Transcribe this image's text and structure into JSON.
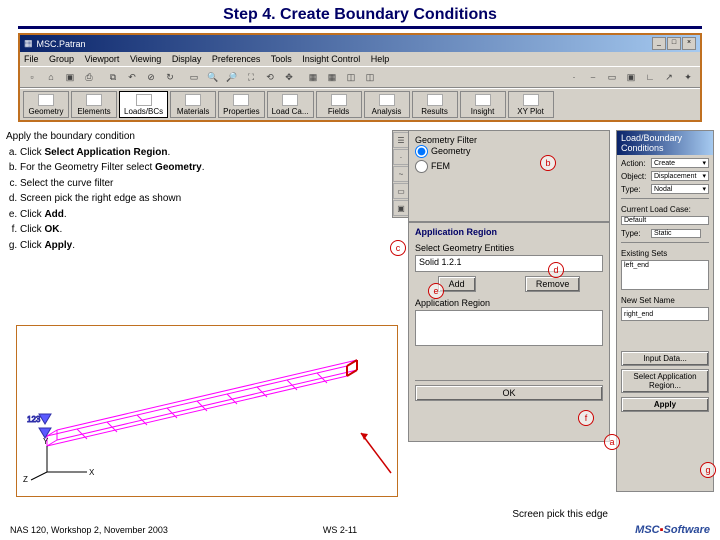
{
  "slide": {
    "title": "Step 4. Create Boundary Conditions"
  },
  "app_window": {
    "title": "MSC.Patran",
    "menus": [
      "File",
      "Group",
      "Viewport",
      "Viewing",
      "Display",
      "Preferences",
      "Tools",
      "Insight Control",
      "Help"
    ],
    "main_tabs": [
      "Geometry",
      "Elements",
      "Loads/BCs",
      "Materials",
      "Properties",
      "Load Ca...",
      "Fields",
      "Analysis",
      "Results",
      "Insight",
      "XY Plot"
    ]
  },
  "instructions": {
    "lead": "Apply the boundary condition",
    "items": [
      {
        "pre": "Click ",
        "bold": "Select Application Region",
        "post": "."
      },
      {
        "pre": "For the Geometry Filter select ",
        "bold": "Geometry",
        "post": "."
      },
      {
        "pre": "Select the curve filter",
        "bold": "",
        "post": ""
      },
      {
        "pre": "Screen pick the right edge as shown",
        "bold": "",
        "post": ""
      },
      {
        "pre": "Click ",
        "bold": "Add",
        "post": "."
      },
      {
        "pre": "Click ",
        "bold": "OK",
        "post": "."
      },
      {
        "pre": "Click ",
        "bold": "Apply",
        "post": "."
      }
    ]
  },
  "geom_filter": {
    "header": "",
    "label": "Geometry Filter",
    "opt_geom": "Geometry",
    "opt_fem": "FEM"
  },
  "app_region": {
    "header": "Application Region",
    "select_label": "Select Geometry Entities",
    "select_value": "Solid 1.2.1",
    "add": "Add",
    "remove": "Remove",
    "list_label": "Application Region",
    "ok": "OK"
  },
  "right_panel": {
    "header": "Load/Boundary Conditions",
    "action_lbl": "Action:",
    "action_val": "Create",
    "object_lbl": "Object:",
    "object_val": "Displacement",
    "type_lbl": "Type:",
    "type_val": "Nodal",
    "curr_lc_lbl": "Current Load Case:",
    "curr_lc_val": "Default",
    "tlbl": "Type:",
    "type2_val": "Static",
    "exist_lbl": "Existing Sets",
    "exist_item": "left_end",
    "setname_lbl": "New Set Name",
    "setname_val": "right_end",
    "input_data": "Input Data...",
    "sel_region": "Select Application Region...",
    "apply": "Apply"
  },
  "markers": {
    "a": "a",
    "b": "b",
    "c": "c",
    "d": "d",
    "e": "e",
    "f": "f",
    "g": "g"
  },
  "footer": {
    "left": "NAS 120, Workshop 2, November 2003",
    "center": "WS 2-11",
    "pick_label": "Screen pick this edge",
    "logo": "MSC.Software"
  }
}
